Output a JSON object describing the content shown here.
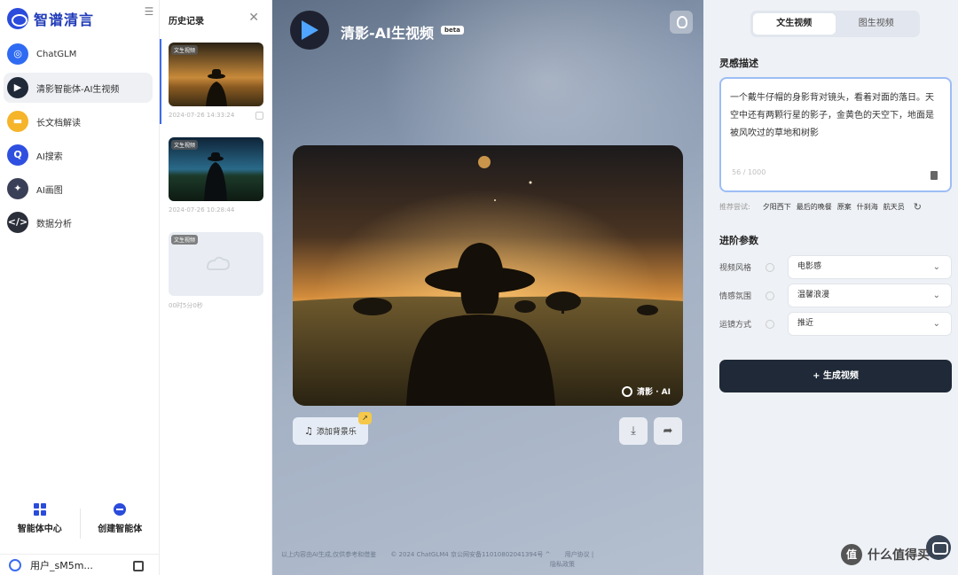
{
  "sidebar": {
    "brand": "智谱清言",
    "items": [
      {
        "label": "ChatGLM",
        "icon": "chatglm-icon",
        "color": "#2f6bf2"
      },
      {
        "label": "清影智能体-AI生视频",
        "icon": "qingying-icon",
        "color": "#1f2937",
        "active": true
      },
      {
        "label": "长文档解读",
        "icon": "folder-icon",
        "color": "#f5b42a"
      },
      {
        "label": "AI搜索",
        "icon": "search-icon",
        "color": "#2f4fe0"
      },
      {
        "label": "AI画图",
        "icon": "paint-icon",
        "color": "#3a3f58"
      },
      {
        "label": "数据分析",
        "icon": "code-icon",
        "color": "#2b2f3a"
      }
    ],
    "bottom": {
      "agents_center": "智能体中心",
      "create_agent": "创建智能体"
    },
    "user": {
      "name": "用户_sM5m..."
    }
  },
  "history": {
    "title": "历史记录",
    "items": [
      {
        "tag": "文生视频",
        "time": "2024-07-26 14:33:24"
      },
      {
        "tag": "文生视频",
        "time": "2024-07-26 10:28:44"
      },
      {
        "tag": "文生视频",
        "time": "00时5分0秒"
      }
    ]
  },
  "stage": {
    "title": "清影-AI生视频",
    "beta": "beta",
    "watermark": "清影 · AI",
    "music_button": "添加背景乐",
    "music_badge": "↗",
    "footer": [
      "以上内容由AI生成,仅供参考和借鉴",
      "© 2024 ChatGLM4 京公网安备11010802041394号 ^",
      "用户协议 |",
      "隐私政策"
    ]
  },
  "panel": {
    "tabs": [
      "文生视频",
      "图生视频"
    ],
    "prompt_label": "灵感描述",
    "prompt_text": "一个戴牛仔帽的身影背对镜头，看着对面的落日。天空中还有两颗行星的影子，金黄色的天空下，地面是被风吹过的草地和树影",
    "prompt_count": "56 / 1000",
    "suggest_lead": "推荐尝试:",
    "suggestions": [
      "夕阳西下",
      "最后的晚餐",
      "原案",
      "什刹海",
      "航天员"
    ],
    "advanced_label": "进阶参数",
    "params": [
      {
        "label": "视频风格",
        "value": "电影感"
      },
      {
        "label": "情感氛围",
        "value": "温馨浪漫"
      },
      {
        "label": "运镜方式",
        "value": "推近"
      }
    ],
    "generate_button": "+ 生成视频"
  },
  "site_watermark": {
    "icon_text": "值",
    "text": "什么值得买"
  },
  "colors": {
    "accent": "#2f6bf2",
    "dark_button": "#1f2937",
    "panel_bg": "#eef1f5"
  }
}
